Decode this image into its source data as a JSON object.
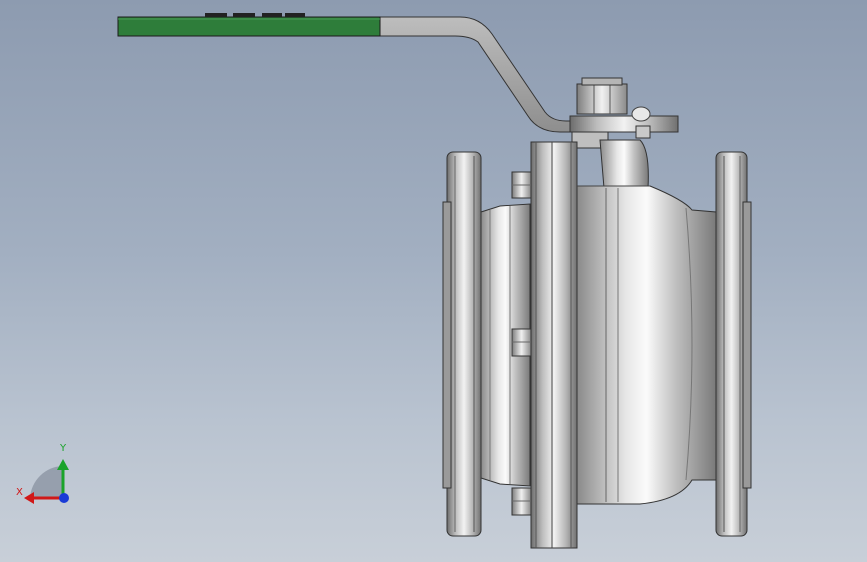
{
  "viewport": {
    "background_top": "#8d9bb0",
    "background_bottom": "#c8cfd8"
  },
  "model": {
    "handle_color": "#2e7d3a",
    "metal_color": "#c9c9c9"
  },
  "triad": {
    "y_label": "Y",
    "x_label": "X",
    "y_color": "#1aa32a",
    "x_color": "#d01818",
    "z_color": "#1a3bd6"
  }
}
